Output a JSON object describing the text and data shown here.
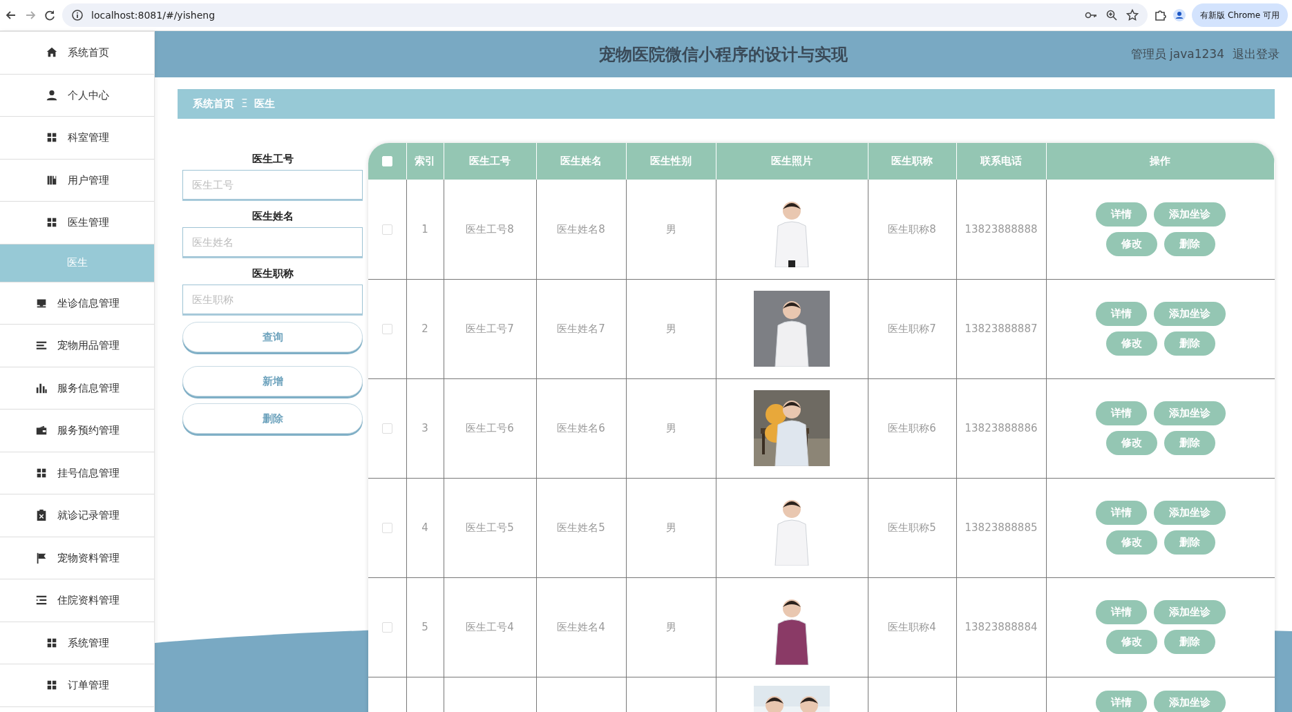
{
  "browser": {
    "url": "localhost:8081/#/yisheng",
    "update_button": "有新版 Chrome 可用"
  },
  "sidebar": {
    "items": [
      {
        "label": "系统首页",
        "kind": "item",
        "selected": false
      },
      {
        "label": "个人中心",
        "kind": "item",
        "selected": false
      },
      {
        "label": "科室管理",
        "kind": "item",
        "selected": false
      },
      {
        "label": "用户管理",
        "kind": "item",
        "selected": false
      },
      {
        "label": "医生管理",
        "kind": "item",
        "selected": false
      },
      {
        "label": "医生",
        "kind": "subitem",
        "selected": true
      },
      {
        "label": "坐诊信息管理",
        "kind": "item",
        "selected": false
      },
      {
        "label": "宠物用品管理",
        "kind": "item",
        "selected": false
      },
      {
        "label": "服务信息管理",
        "kind": "item",
        "selected": false
      },
      {
        "label": "服务预约管理",
        "kind": "item",
        "selected": false
      },
      {
        "label": "挂号信息管理",
        "kind": "item",
        "selected": false
      },
      {
        "label": "就诊记录管理",
        "kind": "item",
        "selected": false
      },
      {
        "label": "宠物资料管理",
        "kind": "item",
        "selected": false
      },
      {
        "label": "住院资料管理",
        "kind": "item",
        "selected": false
      },
      {
        "label": "系统管理",
        "kind": "item",
        "selected": false
      },
      {
        "label": "订单管理",
        "kind": "item",
        "selected": false
      }
    ]
  },
  "header": {
    "title": "宠物医院微信小程序的设计与实现",
    "user": "管理员 java1234",
    "logout": "退出登录"
  },
  "breadcrumb": {
    "items": [
      "系统首页",
      "医生"
    ],
    "separator": "Ξ"
  },
  "search": {
    "fields": [
      {
        "label": "医生工号",
        "placeholder": "医生工号"
      },
      {
        "label": "医生姓名",
        "placeholder": "医生姓名"
      },
      {
        "label": "医生职称",
        "placeholder": "医生职称"
      }
    ],
    "buttons": [
      "查询",
      "新增",
      "删除"
    ]
  },
  "table": {
    "select_all": {
      "checked": false
    },
    "columns": [
      "索引",
      "医生工号",
      "医生姓名",
      "医生性别",
      "医生照片",
      "医生职称",
      "联系电话",
      "操作"
    ],
    "rows": [
      {
        "checked": false,
        "cells": [
          "1",
          "医生工号8",
          "医生姓名8",
          "男",
          null,
          "医生职称8",
          "13823888888"
        ],
        "photo": {
          "kind": "picture"
        },
        "actions": [
          "详情",
          "添加坐诊",
          "修改",
          "删除"
        ]
      },
      {
        "checked": false,
        "cells": [
          "2",
          "医生工号7",
          "医生姓名7",
          "男",
          null,
          "医生职称7",
          "13823888887"
        ],
        "photo": {
          "kind": "picture"
        },
        "actions": [
          "详情",
          "添加坐诊",
          "修改",
          "删除"
        ]
      },
      {
        "checked": false,
        "cells": [
          "3",
          "医生工号6",
          "医生姓名6",
          "男",
          null,
          "医生职称6",
          "13823888886"
        ],
        "photo": {
          "kind": "picture"
        },
        "actions": [
          "详情",
          "添加坐诊",
          "修改",
          "删除"
        ]
      },
      {
        "checked": false,
        "cells": [
          "4",
          "医生工号5",
          "医生姓名5",
          "男",
          null,
          "医生职称5",
          "13823888885"
        ],
        "photo": {
          "kind": "picture"
        },
        "actions": [
          "详情",
          "添加坐诊",
          "修改",
          "删除"
        ]
      },
      {
        "checked": false,
        "cells": [
          "5",
          "医生工号4",
          "医生姓名4",
          "男",
          null,
          "医生职称4",
          "13823888884"
        ],
        "photo": {
          "kind": "picture"
        },
        "actions": [
          "详情",
          "添加坐诊",
          "修改",
          "删除"
        ]
      },
      {
        "cells": [
          null,
          null,
          null,
          null,
          null,
          null,
          null
        ],
        "photo": {
          "kind": "picture"
        },
        "actions": [
          "详情",
          "添加坐诊"
        ]
      }
    ]
  }
}
